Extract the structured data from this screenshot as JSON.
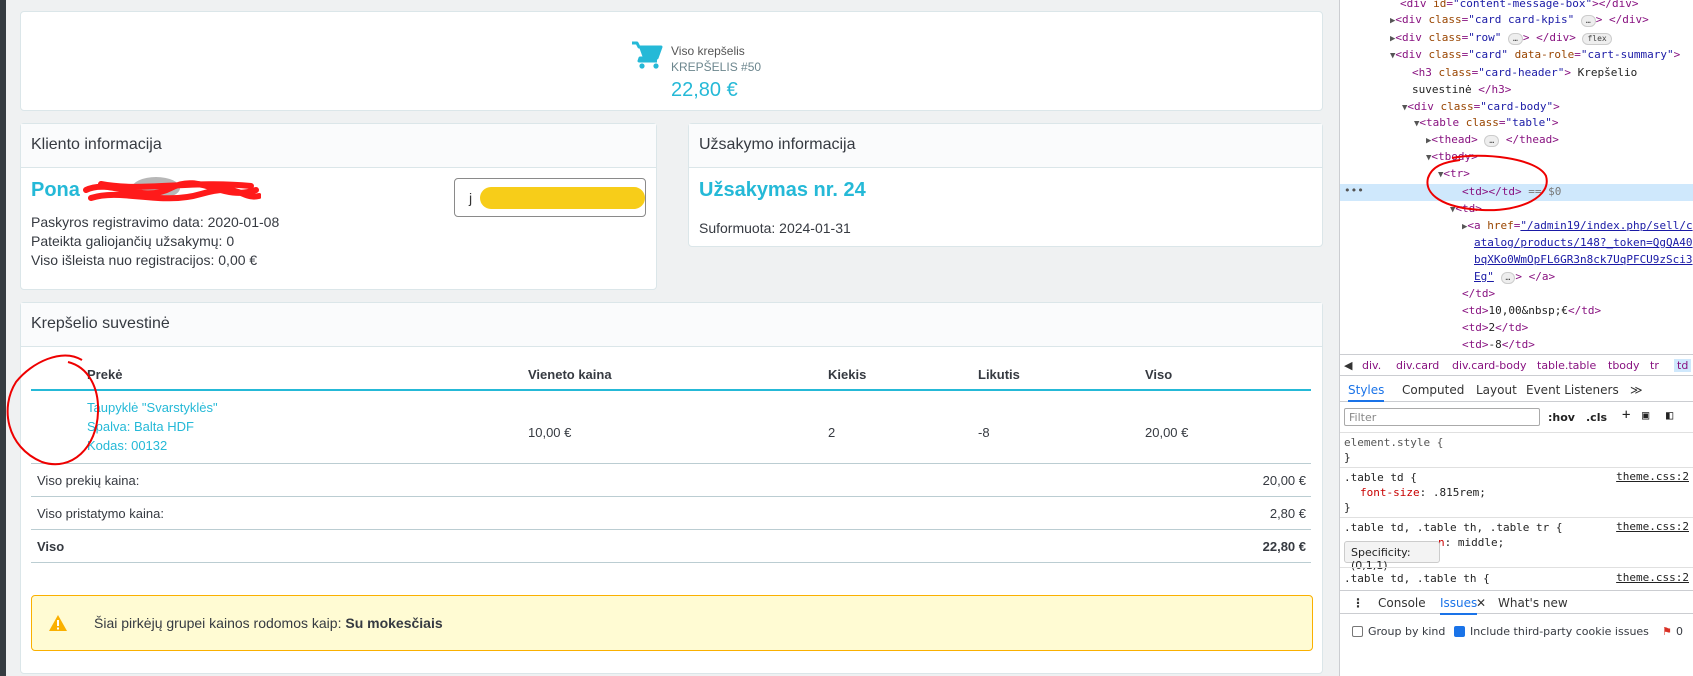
{
  "kpi": {
    "title": "Viso krepšelis",
    "subtitle": "KREPŠELIS #50",
    "value": "22,80 €",
    "icon": "shopping-cart-icon"
  },
  "customer": {
    "header": "Kliento informacija",
    "name": "Pona",
    "email_prefix": "j",
    "lines": [
      "Paskyros registravimo data: 2020-01-08",
      "Pateikta galiojančių užsakymų: 0",
      "Viso išleista nuo registracijos: 0,00 €"
    ]
  },
  "order": {
    "header": "Užsakymo informacija",
    "title": "Užsakymas nr. 24",
    "created": "Suformuota: 2024-01-31"
  },
  "summary": {
    "header": "Krepšelio suvestinė",
    "columns": [
      "Prekė",
      "Vieneto kaina",
      "Kiekis",
      "Likutis",
      "Viso"
    ],
    "product": {
      "name": "Taupyklė \"Svarstyklės\"",
      "color": "Spalva: Balta HDF",
      "code": "Kodas: 00132",
      "unit_price": "10,00 €",
      "qty": "2",
      "stock": "-8",
      "total": "20,00 €"
    },
    "totals": [
      {
        "label": "Viso prekių kaina:",
        "value": "20,00 €"
      },
      {
        "label": "Viso pristatymo kaina:",
        "value": "2,80 €"
      },
      {
        "label": "Viso",
        "value": "22,80 €"
      }
    ],
    "alert_text": "Šiai pirkėjų grupei kainos rodomos kaip:",
    "alert_bold": "Su mokesčiais"
  },
  "devtools": {
    "tree": {
      "l1_tag": "<div ",
      "l1_attr": "id",
      "l1_val": "\"content-message-box\"",
      "l1_end": "></div>",
      "l2_tag": "<div ",
      "l2_attr": "class",
      "l2_val": "\"card card-kpis\"",
      "l2_end": "> </div>",
      "l3_tag": "<div ",
      "l3_attr": "class",
      "l3_val": "\"row\"",
      "l3_end": "> </div>",
      "l3_pill": "flex",
      "l4_tag": "<div ",
      "l4_attr": "class",
      "l4_val": "\"card\"",
      "l4_attr2": "data-role",
      "l4_val2": "\"cart-summary\"",
      "l5_tag": "<h3 ",
      "l5_attr": "class",
      "l5_val": "\"card-header\"",
      "l5_text": " Krepšelio",
      "l6_text": "suvestinė ",
      "l6_end": "</h3>",
      "l7_tag": "<div ",
      "l7_attr": "class",
      "l7_val": "\"card-body\"",
      "l8_tag": "<table ",
      "l8_attr": "class",
      "l8_val": "\"table\"",
      "l9_tag": "<thead>",
      "l9_end": "</thead>",
      "l10_tag": "<tbody>",
      "l11_tag": "<tr>",
      "l12_tag": "<td></td>",
      "l12_eq": " == $0",
      "l13_tag": "<td>",
      "l14_tag": "<a ",
      "l14_attr": "href",
      "l14_val": "\"/admin19/index.php/sell/c",
      "l15_val": "atalog/products/148?_token=QgQA40",
      "l16_val": "bqXKo0WmOpFL6GR3n8ck7UqPFCU9zSci3",
      "l17_val": "Eg\"",
      "l17_end": "> </a>",
      "l18_tag": "</td>",
      "l19_tag": "<td>",
      "l19_text": "10,00&nbsp;€",
      "l19_end": "</td>",
      "l20_tag": "<td>",
      "l20_text": "2",
      "l20_end": "</td>",
      "l21_tag": "<td>",
      "l21_text": "-8",
      "l21_end": "</td>"
    },
    "breadcrumbs": [
      "div.",
      "div.card",
      "div.card-body",
      "table.table",
      "tbody",
      "tr",
      "td"
    ],
    "tabs": [
      "Styles",
      "Computed",
      "Layout",
      "Event Listeners",
      "≫"
    ],
    "filter_placeholder": "Filter",
    "hov": ":hov",
    "cls": ".cls",
    "rules": {
      "r1_sel": "element.style {",
      "r1_end": "}",
      "r2_sel": ".table td {",
      "r2_prop": "font-size",
      "r2_val": ": .815rem;",
      "r2_end": "}",
      "r2_src": "theme.css:2",
      "r3_sel": ".table td, .table th, .table tr {",
      "r3_prop": "n",
      "r3_val": ": middle;",
      "r3_src": "theme.css:2",
      "r4_sel": ".table td, .table th {",
      "r4_src": "theme.css:2"
    },
    "tooltip": "Specificity: (0,1,1)",
    "drawer_tabs": [
      "Console",
      "Issues",
      "What's new"
    ],
    "option1": "Group by kind",
    "option2": "Include third-party cookie issues",
    "issues_count": "0"
  }
}
